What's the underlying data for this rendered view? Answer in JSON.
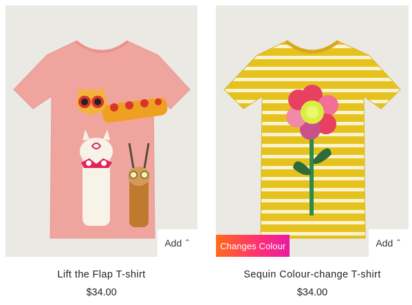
{
  "products": [
    {
      "name": "Lift the Flap T-shirt",
      "price": "$34.00",
      "add_label": "Add",
      "add_icon": "chevron-up-icon",
      "colors": {
        "shirt": "#efa59e",
        "background": "#ebe9e4"
      }
    },
    {
      "name": "Sequin Colour-change T-shirt",
      "price": "$34.00",
      "add_label": "Add",
      "add_icon": "chevron-up-icon",
      "badge": "Changes Colour",
      "colors": {
        "shirt": "#e5c21d",
        "stripe": "#fbf3d2",
        "background": "#ebe9e4"
      }
    }
  ]
}
